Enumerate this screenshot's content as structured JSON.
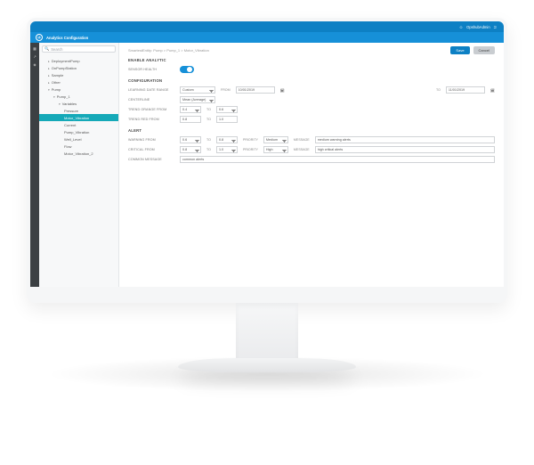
{
  "topbar": {
    "user_label": "OpshubAdmin"
  },
  "app": {
    "title": "Analytics Configuration"
  },
  "search": {
    "placeholder": "Search"
  },
  "tree": {
    "n0": "DeploymentPump",
    "n1": "OnPumpStation",
    "n2": "Sample",
    "n3": "Other",
    "n4": "Pump",
    "n5": "Pump_1",
    "n6": "Variables",
    "n7": "Pressure",
    "n8": "Motor_Vibration",
    "n9": "Current",
    "n10": "Pump_Vibration",
    "n11": "Well_Level",
    "n12": "Flow",
    "n13": "Motor_Vibration_2"
  },
  "actions": {
    "save": "Save",
    "cancel": "Cancel"
  },
  "breadcrumb": "SmartestEntity: Pump > Pump_1 > Motor_Vibration",
  "sections": {
    "enable": "ENABLE ANALYTIC",
    "config": "CONFIGURATION",
    "alert": "ALERT"
  },
  "labels": {
    "sensor_health": "SENSOR HEALTH",
    "learning_range": "LEARNING DATE RANGE",
    "centerline": "CENTERLINE",
    "trend_orange": "TREND ORANGE FROM",
    "trend_red": "TREND RED FROM",
    "warning": "WARNING FROM",
    "critical": "CRITICAL FROM",
    "common_msg": "COMMON MESSAGE",
    "from": "FROM",
    "to": "TO",
    "to_lc": "To",
    "priority": "PRIORITY",
    "message": "MESSAGE"
  },
  "values": {
    "date_range_type": "Custom",
    "date_from": "10/01/2019",
    "date_to": "11/01/2019",
    "centerline_mode": "Mean (Average)",
    "trend_orange_from": "0.4",
    "trend_orange_to": "0.6",
    "trend_red_from": "0.8",
    "trend_red_to": "1.0",
    "warn_from": "0.6",
    "warn_to": "0.8",
    "warn_priority": "Medium",
    "warn_msg": "medium warning alerts",
    "crit_from": "0.8",
    "crit_to": "1.0",
    "crit_priority": "High",
    "crit_msg": "high critical alerts",
    "common_msg": "common alerts"
  }
}
